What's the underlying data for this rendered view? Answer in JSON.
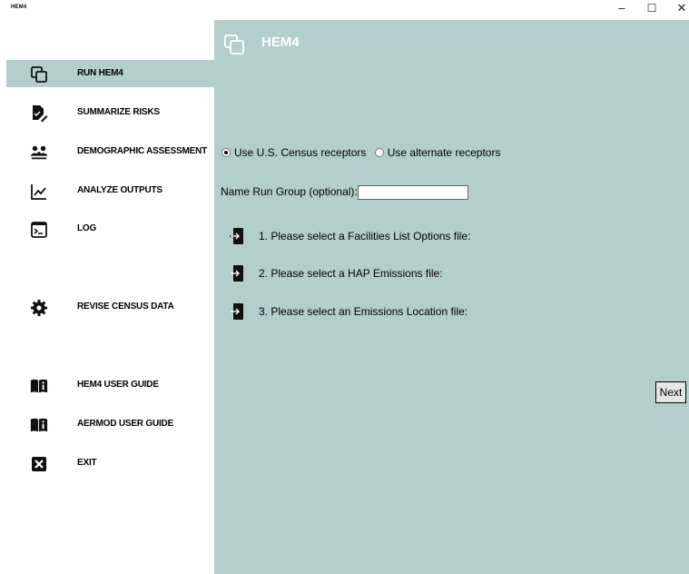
{
  "window": {
    "title": "HEM4",
    "minimize": "–",
    "maximize": "☐",
    "close": "✕"
  },
  "sidebar": {
    "items": [
      {
        "label": "RUN HEM4",
        "icon": "copy-windows-icon",
        "active": true
      },
      {
        "label": "SUMMARIZE RISKS",
        "icon": "document-edit-icon",
        "active": false
      },
      {
        "label": "DEMOGRAPHIC ASSESSMENT",
        "icon": "people-icon",
        "active": false
      },
      {
        "label": "ANALYZE OUTPUTS",
        "icon": "line-chart-icon",
        "active": false
      },
      {
        "label": "LOG",
        "icon": "terminal-icon",
        "active": false
      },
      {
        "label": "REVISE CENSUS DATA",
        "icon": "gear-icon",
        "active": false
      },
      {
        "label": "HEM4 USER GUIDE",
        "icon": "book-info-icon",
        "active": false
      },
      {
        "label": "AERMOD USER GUIDE",
        "icon": "book-info-icon",
        "active": false
      },
      {
        "label": "EXIT",
        "icon": "close-box-icon",
        "active": false
      }
    ]
  },
  "main": {
    "title": "HEM4",
    "title_icon": "copy-windows-icon",
    "receptor_options": [
      {
        "label": "Use U.S. Census receptors",
        "selected": true
      },
      {
        "label": "Use alternate receptors",
        "selected": false
      }
    ],
    "run_group": {
      "label": "Name Run Group (optional):",
      "value": ""
    },
    "file_steps": [
      {
        "label": "1. Please select a Facilities List Options file:",
        "icon": "file-import-icon"
      },
      {
        "label": "2. Please select a HAP Emissions file:",
        "icon": "file-import-icon"
      },
      {
        "label": "3. Please select an Emissions Location file:",
        "icon": "file-import-icon"
      }
    ],
    "next_label": "Next"
  },
  "colors": {
    "panel": "#b4cdcd",
    "active_nav": "#b4cdcd",
    "header_text": "#ffffff"
  }
}
